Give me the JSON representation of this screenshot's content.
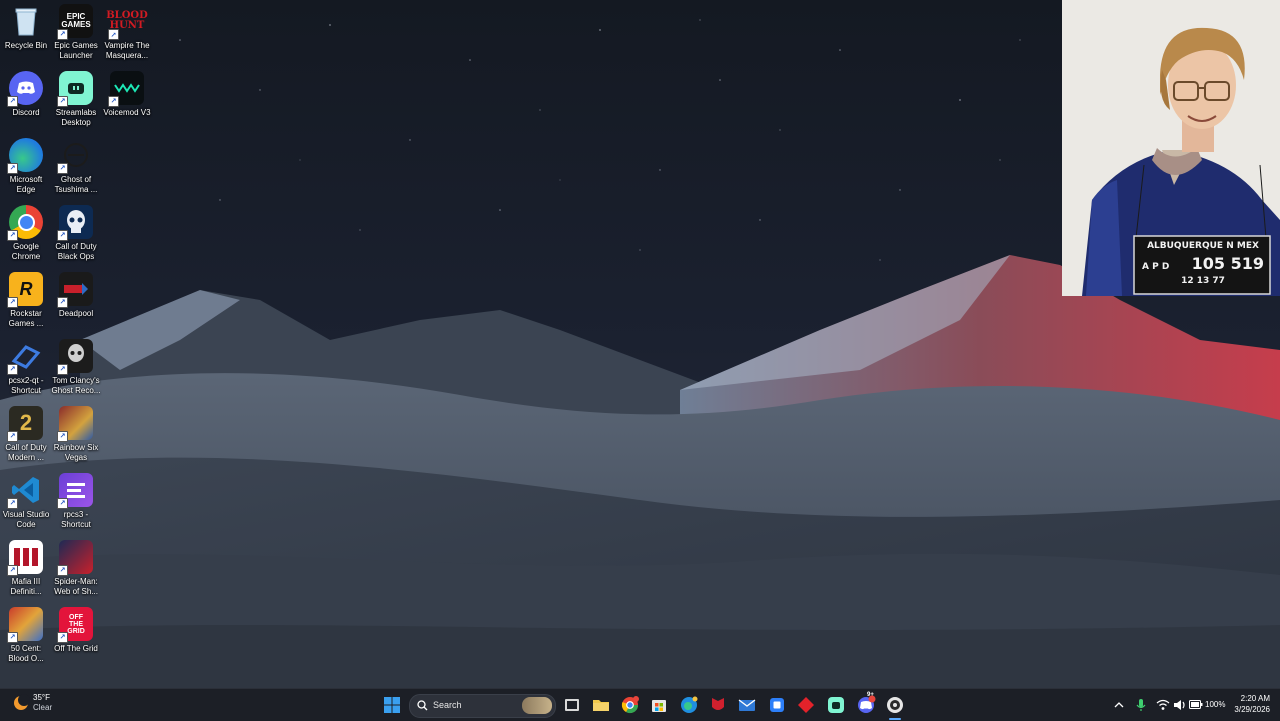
{
  "desktop": {
    "icons": [
      {
        "label": "Recycle Bin",
        "icon": "recycle-bin-icon"
      },
      {
        "label": "Epic Games\nLauncher",
        "icon": "epic-games-icon",
        "badge": "EPIC\nGAMES"
      },
      {
        "label": "Vampire The\nMasquera...",
        "icon": "bloodhunt-icon",
        "badge": "BLOOD\nHUNT"
      },
      {
        "label": "Discord",
        "icon": "discord-icon"
      },
      {
        "label": "Streamlabs\nDesktop",
        "icon": "streamlabs-icon"
      },
      {
        "label": "Voicemod V3",
        "icon": "voicemod-icon"
      },
      {
        "label": "Microsoft\nEdge",
        "icon": "edge-icon"
      },
      {
        "label": "Ghost of\nTsushima ...",
        "icon": "ghost-of-tsushima-icon"
      },
      {
        "label": "Google\nChrome",
        "icon": "chrome-icon"
      },
      {
        "label": "Call of Duty\nBlack Ops",
        "icon": "call-of-duty-black-ops-icon"
      },
      {
        "label": "Rockstar\nGames ...",
        "icon": "rockstar-icon",
        "badge": "R"
      },
      {
        "label": "Deadpool",
        "icon": "deadpool-icon"
      },
      {
        "label": "pcsx2-qt -\nShortcut",
        "icon": "pcsx2-icon"
      },
      {
        "label": "Tom Clancy's\nGhost Reco...",
        "icon": "ghost-recon-icon"
      },
      {
        "label": "Call of Duty\nModern ...",
        "icon": "call-of-duty-mw-icon",
        "badge": "2"
      },
      {
        "label": "Rainbow Six\nVegas",
        "icon": "rainbow-six-icon"
      },
      {
        "label": "Visual Studio\nCode",
        "icon": "vscode-icon"
      },
      {
        "label": "rpcs3 -\nShortcut",
        "icon": "rpcs3-icon"
      },
      {
        "label": "Mafia III\nDefiniti...",
        "icon": "mafia-icon"
      },
      {
        "label": "Spider-Man:\nWeb of Sh...",
        "icon": "spiderman-icon"
      },
      {
        "label": "50 Cent:\nBlood O...",
        "icon": "fifty-cent-icon"
      },
      {
        "label": "Off The Grid",
        "icon": "off-the-grid-icon",
        "badge": "OFF\nTHE\nGRID"
      }
    ]
  },
  "photo": {
    "sign_line1": "ALBUQUERQUE  N MEX",
    "sign_line2a": "A P D",
    "sign_line2b": "105 519",
    "sign_line3": "12  13  77"
  },
  "taskbar": {
    "weather": {
      "temp": "35°F",
      "condition": "Clear"
    },
    "search_label": "Search",
    "tray": {
      "battery": "100%"
    },
    "clock": {
      "time": "2:20 AM",
      "date": "3/29/2026"
    },
    "discord_badge": "9+"
  },
  "colors": {
    "taskbar_bg": "#1c1f26",
    "sky": "#161b25",
    "dune": "#4a5464",
    "red_light": "#b23a48"
  }
}
